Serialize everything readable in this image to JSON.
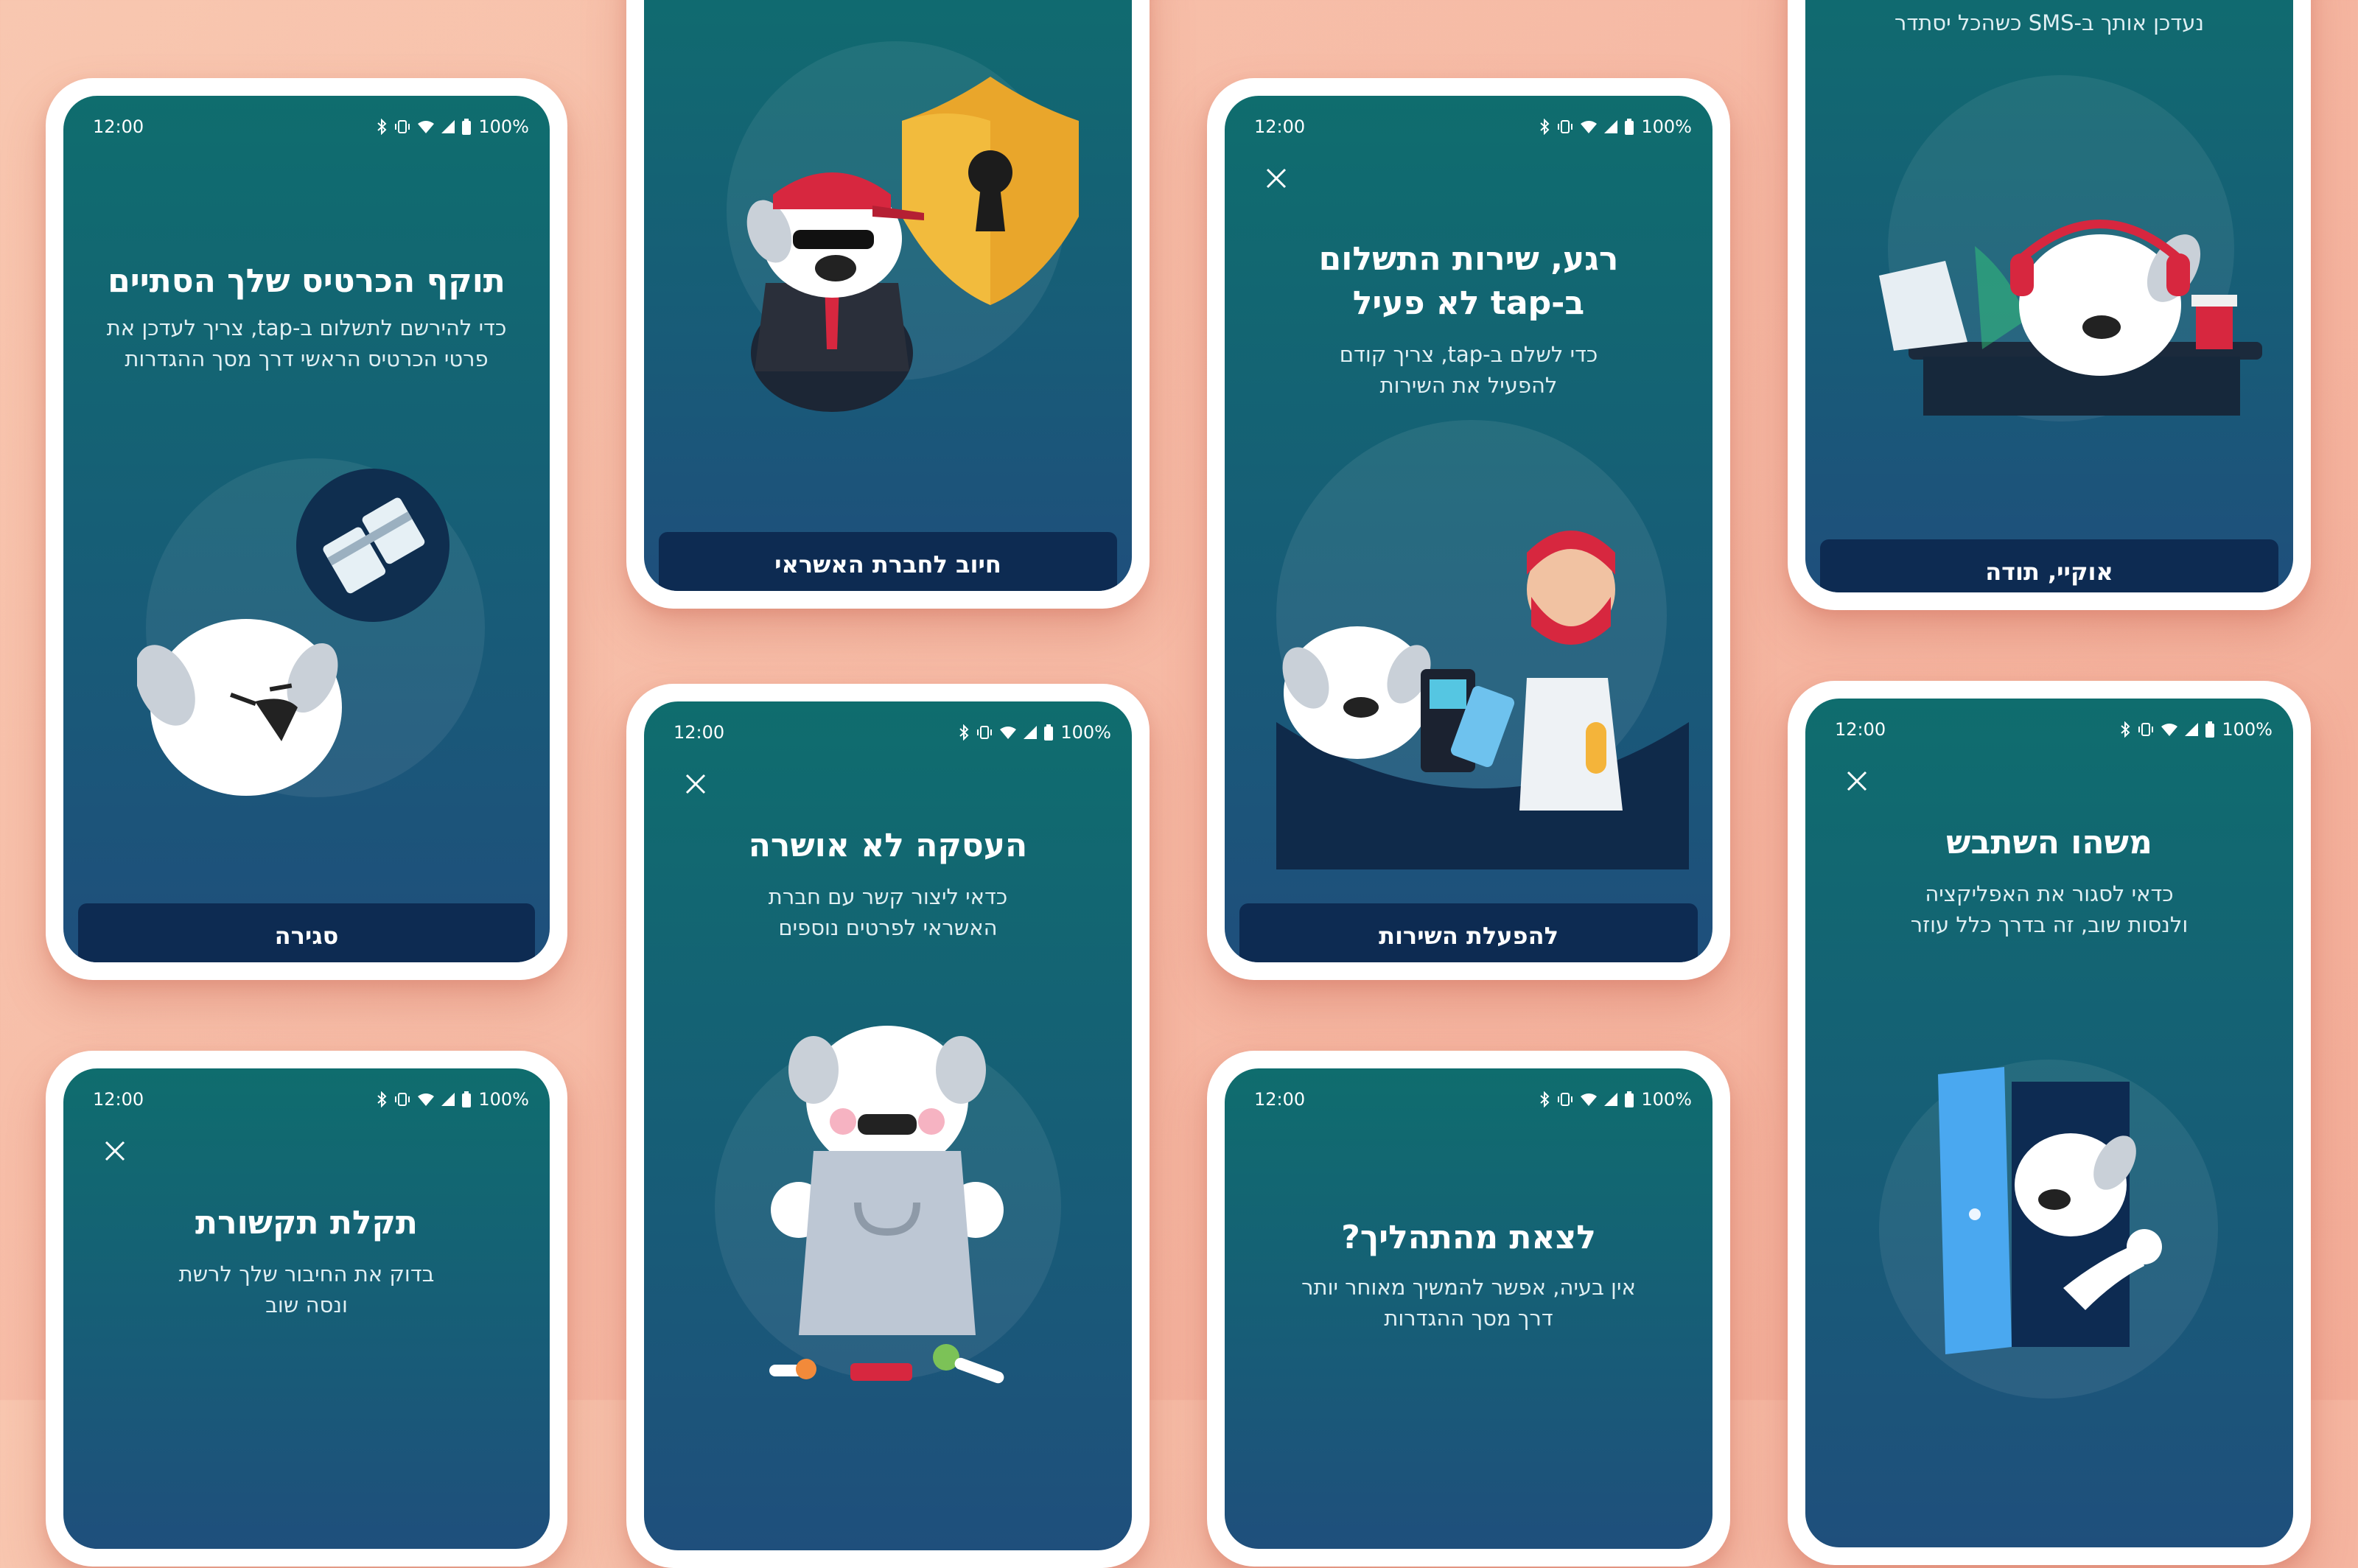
{
  "status": {
    "time": "12:00",
    "battery": "100%"
  },
  "cards": {
    "card_expired": {
      "title": "תוקף הכרטיס שלך הסתיים",
      "subtitle": "כדי להירשם לתשלום ב-tap, צריך לעדכן את\nפרטי הכרטיס הראשי דרך מסך ההגדרות",
      "button": "סגירה"
    },
    "credit_charge": {
      "button": "חיוב לחברת האשראי"
    },
    "service_inactive": {
      "title_line1": "רגע, שירות התשלום",
      "title_line2": "ב-tap לא פעיל",
      "subtitle": "כדי לשלם ב-tap, צריך קודם\nלהפעיל את השירות",
      "button": "להפעלת השירות"
    },
    "sms_update": {
      "top_text": "נעדכן אותך ב-SMS כשהכל יסתדר",
      "button": "אוקיי, תודה"
    },
    "connection_error": {
      "title": "תקלת תקשורת",
      "subtitle": "בדוק את החיבור שלך לרשת\nונסה שוב"
    },
    "transaction_denied": {
      "title": "העסקה לא אושרה",
      "subtitle": "כדאי ליצור קשר עם חברת\nהאשראי לפרטים נוספים"
    },
    "exit_process": {
      "title": "לצאת מהתהליך?",
      "subtitle": "אין בעיה, אפשר להמשיך מאוחר יותר\nדרך מסך ההגדרות"
    },
    "something_broke": {
      "title": "משהו השתבש",
      "subtitle": "כדאי לסגור את האפליקציה\nולנסות שוב, זה בדרך כלל עוזר"
    }
  },
  "icons": [
    "bluetooth-icon",
    "vibrate-icon",
    "wifi-icon",
    "signal-icon",
    "battery-icon",
    "close-icon"
  ],
  "colors": {
    "background": "#f6b9a4",
    "screen_top": "#0f6d6e",
    "screen_bottom": "#1f4f7c",
    "button": "#0d2b52",
    "accent_red": "#d7273f"
  }
}
